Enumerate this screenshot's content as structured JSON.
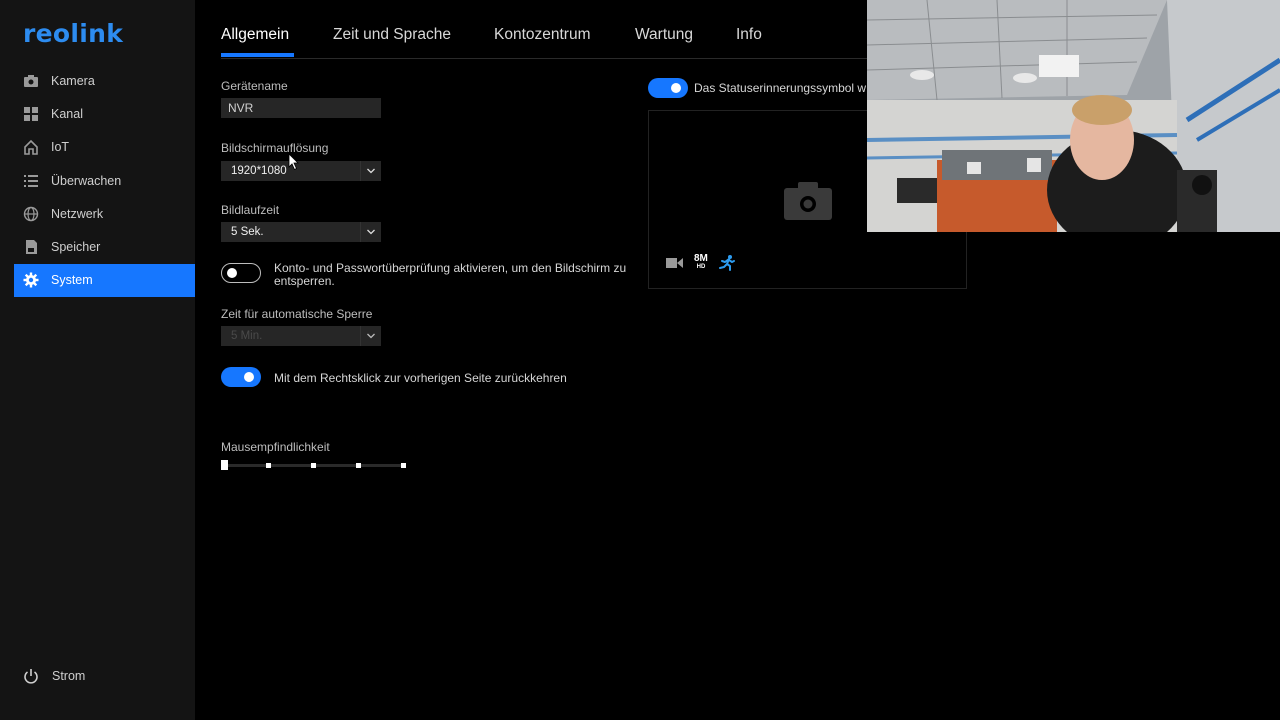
{
  "app": {
    "logo": "reolink"
  },
  "sidebar": {
    "items": [
      {
        "label": "Kamera",
        "icon": "camera-icon"
      },
      {
        "label": "Kanal",
        "icon": "grid-icon"
      },
      {
        "label": "IoT",
        "icon": "home-icon"
      },
      {
        "label": "Überwachen",
        "icon": "list-icon"
      },
      {
        "label": "Netzwerk",
        "icon": "globe-icon"
      },
      {
        "label": "Speicher",
        "icon": "storage-icon"
      },
      {
        "label": "System",
        "icon": "gear-icon",
        "active": true
      }
    ],
    "power_label": "Strom"
  },
  "tabs": [
    "Allgemein",
    "Zeit und Sprache",
    "Kontozentrum",
    "Wartung",
    "Info"
  ],
  "active_tab": "Allgemein",
  "form": {
    "device_name_label": "Gerätename",
    "device_name_value": "NVR",
    "resolution_label": "Bildschirmauflösung",
    "resolution_value": "1920*1080",
    "image_runtime_label": "Bildlaufzeit",
    "image_runtime_value": "5 Sek.",
    "password_check_label": "Konto- und Passwortüberprüfung aktivieren, um den Bildschirm zu entsperren.",
    "password_check_enabled": false,
    "auto_lock_label": "Zeit für automatische Sperre",
    "auto_lock_value": "5 Min.",
    "right_click_label": "Mit dem Rechtsklick zur vorherigen Seite zurückkehren",
    "right_click_enabled": true,
    "mouse_sensitivity_label": "Mausempfindlichkeit",
    "mouse_sensitivity_steps": 5,
    "mouse_sensitivity_value": 1
  },
  "status_reminder": {
    "label": "Das Statuserinnerungssymbol w",
    "enabled": true
  },
  "preview": {
    "resolution_badge_top": "8M",
    "resolution_badge_bottom": "HD"
  },
  "colors": {
    "accent": "#1677ff",
    "sidebar_bg": "#141414",
    "content_bg": "#000000"
  }
}
